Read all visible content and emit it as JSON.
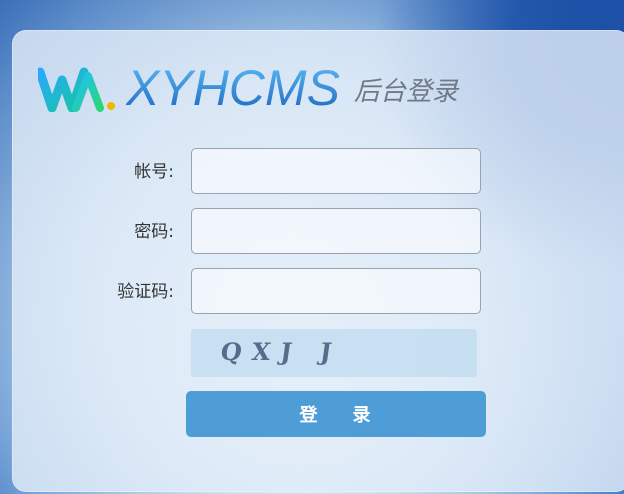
{
  "brand": {
    "logo_text": "XYHCMS",
    "subtitle": "后台登录",
    "colors": {
      "accent": "#4f9dd6",
      "logo_blue": "#2f86d6",
      "logo_green": "#22c87a"
    }
  },
  "form": {
    "username_label": "帐号:",
    "username_value": "",
    "password_label": "密码:",
    "password_value": "",
    "captcha_label": "验证码:",
    "captcha_value": "",
    "captcha_image_text": "QXJ J",
    "submit_label": "登    录"
  },
  "icons": {
    "logo": "xyhcms-logo-icon"
  }
}
